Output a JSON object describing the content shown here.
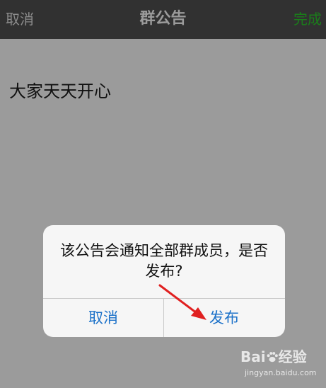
{
  "navbar": {
    "cancel_label": "取消",
    "title": "群公告",
    "done_label": "完成",
    "done_color": "#1a7d1a"
  },
  "content": {
    "announcement_text": "大家天天开心"
  },
  "dialog": {
    "message": "该公告会通知全部群成员，是否发布?",
    "cancel_label": "取消",
    "publish_label": "发布",
    "button_color": "#1d72c9"
  },
  "watermark": {
    "brand_left": "Bai",
    "brand_right": "经验",
    "url": "jingyan.baidu.com",
    "icon": "paw-icon"
  },
  "annotation": {
    "icon": "red-arrow-icon",
    "color": "#e02020"
  }
}
